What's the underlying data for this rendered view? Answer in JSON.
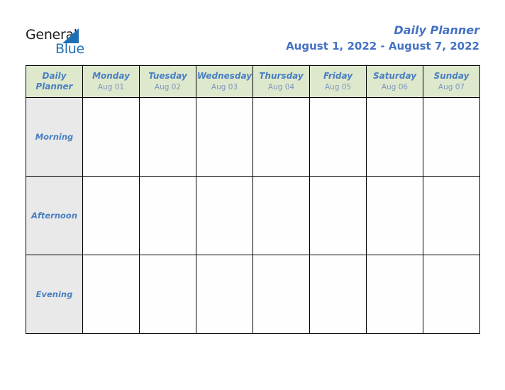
{
  "logo": {
    "word1": "General",
    "word2": "Blue",
    "triangle_color": "#1f6fb5",
    "word1_color": "#1a1a1a",
    "word2_color": "#1f6fb5"
  },
  "header": {
    "title": "Daily Planner",
    "date_range": "August 1, 2022 - August 7, 2022",
    "title_color": "#4472c4"
  },
  "table": {
    "corner": {
      "line1": "Daily",
      "line2": "Planner"
    },
    "header_bg": "#dde8cd",
    "row_label_bg": "#e9e9e9",
    "day_color": "#4a7fc1",
    "date_color": "#7e97bd",
    "days": [
      {
        "name": "Monday",
        "date": "Aug 01"
      },
      {
        "name": "Tuesday",
        "date": "Aug 02"
      },
      {
        "name": "Wednesday",
        "date": "Aug 03"
      },
      {
        "name": "Thursday",
        "date": "Aug 04"
      },
      {
        "name": "Friday",
        "date": "Aug 05"
      },
      {
        "name": "Saturday",
        "date": "Aug 06"
      },
      {
        "name": "Sunday",
        "date": "Aug 07"
      }
    ],
    "time_slots": [
      {
        "label": "Morning",
        "entries": [
          "",
          "",
          "",
          "",
          "",
          "",
          ""
        ]
      },
      {
        "label": "Afternoon",
        "entries": [
          "",
          "",
          "",
          "",
          "",
          "",
          ""
        ]
      },
      {
        "label": "Evening",
        "entries": [
          "",
          "",
          "",
          "",
          "",
          "",
          ""
        ]
      }
    ]
  }
}
